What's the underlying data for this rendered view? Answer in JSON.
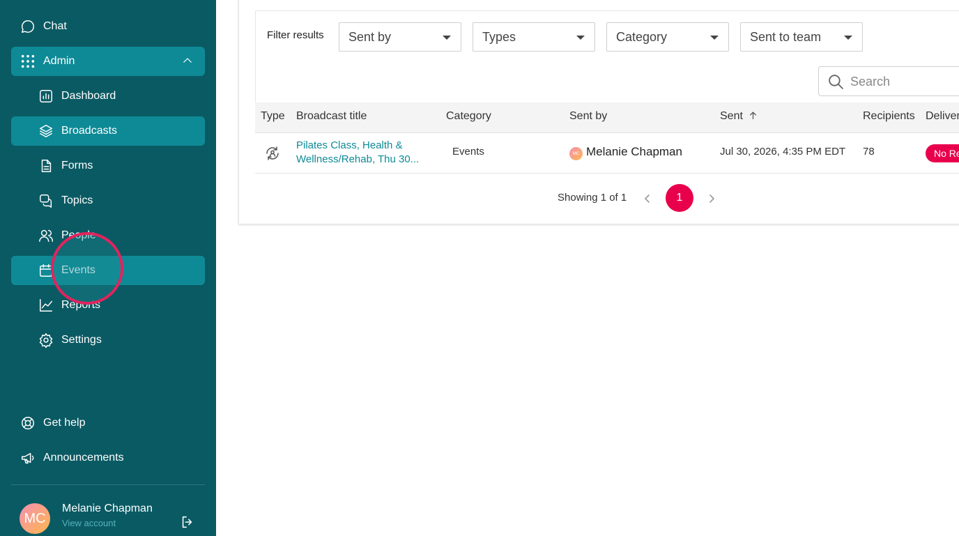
{
  "sidebar": {
    "chat": "Chat",
    "admin": "Admin",
    "items": [
      {
        "label": "Dashboard",
        "icon": "chart-icon"
      },
      {
        "label": "Broadcasts",
        "icon": "layers-icon"
      },
      {
        "label": "Forms",
        "icon": "document-icon"
      },
      {
        "label": "Topics",
        "icon": "chat-bubbles-icon"
      },
      {
        "label": "People",
        "icon": "people-icon"
      },
      {
        "label": "Events",
        "icon": "calendar-icon"
      },
      {
        "label": "Reports",
        "icon": "trend-icon"
      },
      {
        "label": "Settings",
        "icon": "gear-icon"
      }
    ],
    "get_help": "Get help",
    "announcements": "Announcements",
    "user": {
      "initials": "MC",
      "name": "Melanie Chapman",
      "link": "View account"
    }
  },
  "filters": {
    "label": "Filter results",
    "dropdowns": [
      "Sent by",
      "Types",
      "Category",
      "Sent to team"
    ],
    "search_placeholder": "Search"
  },
  "table": {
    "headers": [
      "Type",
      "Broadcast title",
      "Category",
      "Sent by",
      "Sent",
      "Recipients",
      "Delivery"
    ],
    "sent_sort": "ascending",
    "rows": [
      {
        "title": "Pilates Class, Health & Wellness/Rehab, Thu 30...",
        "category": "Events",
        "sender_initials": "MC",
        "sender": "Melanie Chapman",
        "sent": "Jul 30, 2026, 4:35 PM EDT",
        "recipients": "78",
        "status": "No Replies"
      }
    ]
  },
  "pagination": {
    "text": "Showing 1 of 1",
    "current": "1"
  },
  "colors": {
    "sidebar": "#0a5a63",
    "active": "#0e8a96",
    "accent": "#e8004c",
    "link": "#0e8a96"
  }
}
